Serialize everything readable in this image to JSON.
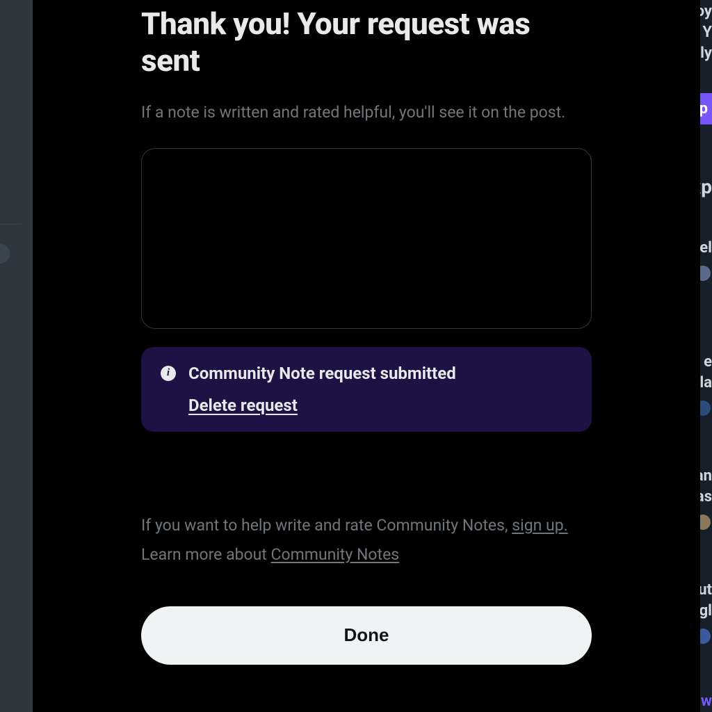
{
  "modal": {
    "title": "Thank you! Your request was sent",
    "subtitle": "If a note is written and rated helpful, you'll see it on the post.",
    "status": {
      "text": "Community Note request submitted",
      "delete_label": "Delete request"
    },
    "help": {
      "line1_prefix": "If you want to help write and rate Community Notes, ",
      "line1_link": "sign up.",
      "line2_prefix": "Learn more about ",
      "line2_link": "Community Notes"
    },
    "done_label": "Done"
  },
  "background": {
    "upgrade_label": "Up",
    "snippets": {
      "s1a": "oy",
      "s1b": "r Y",
      "s1c": "ly",
      "s2": "xp",
      "s3": "el",
      "s4a": "e",
      "s4b": "la",
      "s5a": "an",
      "s5b": "as",
      "s6a": "ut",
      "s6b": "igl",
      "s7": "ow"
    }
  }
}
